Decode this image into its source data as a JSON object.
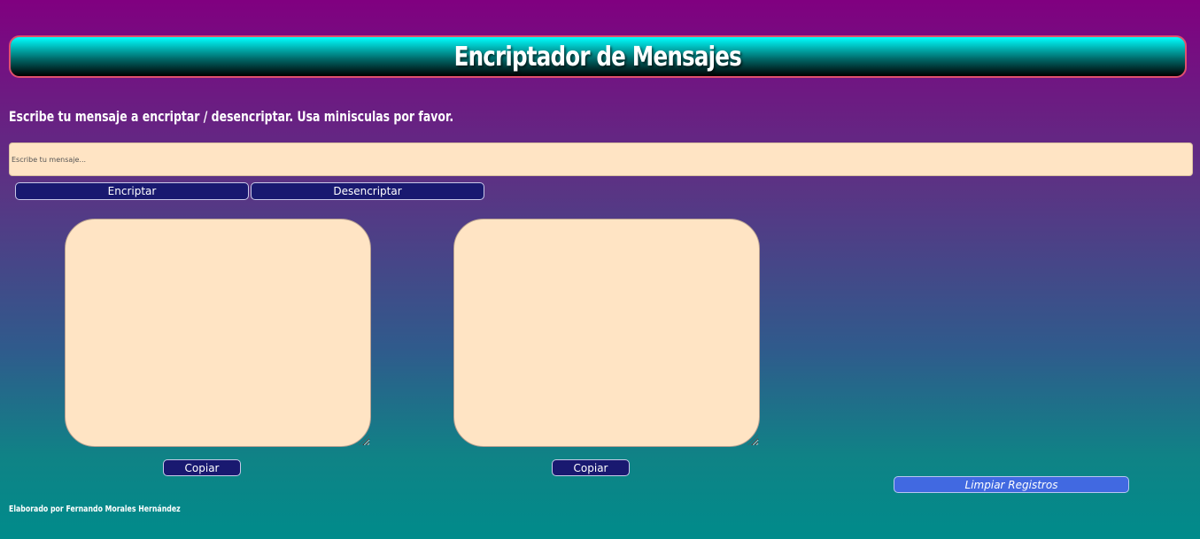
{
  "header": {
    "title": "Encriptador de Mensajes"
  },
  "instruction": "Escribe tu mensaje a encriptar / desencriptar. Usa minisculas por favor.",
  "message_input": {
    "value": "",
    "placeholder": "Escribe tu mensaje..."
  },
  "actions": {
    "encrypt_label": "Encriptar",
    "decrypt_label": "Desencriptar"
  },
  "outputs": [
    {
      "value": "",
      "copy_label": "Copiar"
    },
    {
      "value": "",
      "copy_label": "Copiar"
    }
  ],
  "clear_label": "Limpiar Registros",
  "footer": "Elaborado por Fernando Morales Hernández",
  "colors": {
    "background_top": "#800080",
    "background_bottom": "#008b8b",
    "button": "#191970",
    "clear_button": "#4169e1",
    "field": "#ffe4c4"
  }
}
